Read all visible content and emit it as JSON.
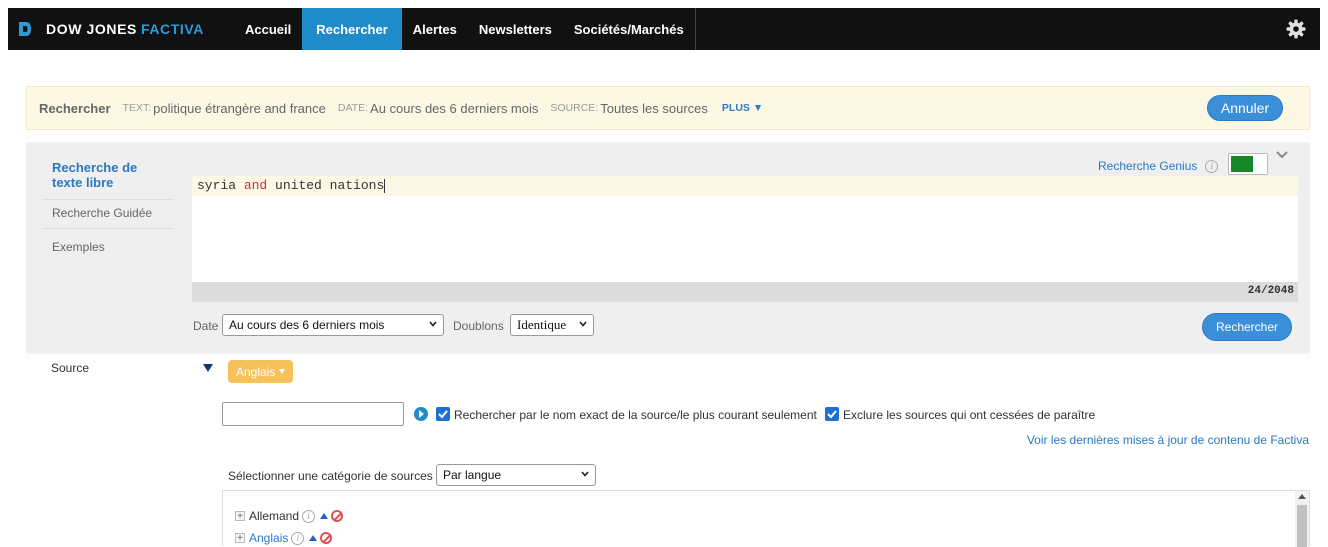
{
  "brand": {
    "name": "DOW JONES",
    "accent": "FACTIVA",
    "accent_color": "#2b9ad8"
  },
  "nav": {
    "items": [
      "Accueil",
      "Rechercher",
      "Alertes",
      "Newsletters",
      "Sociétés/Marchés"
    ],
    "active": "Rechercher"
  },
  "summary": {
    "title": "Rechercher",
    "text_key": "TEXT:",
    "text_value": "politique étrangère and france",
    "date_key": "DATE:",
    "date_value": "Au cours des 6 derniers mois",
    "source_key": "SOURCE:",
    "source_value": "Toutes les sources",
    "more": "PLUS",
    "cancel_label": "Annuler"
  },
  "sidebar": {
    "active": "Recherche de texte libre",
    "items": [
      "Recherche Guidée",
      "Exemples"
    ]
  },
  "genius": {
    "label": "Recherche Genius",
    "info": "i",
    "enabled": true,
    "toggle_color": "#16862a"
  },
  "editor": {
    "parts": [
      "syria",
      "and",
      "united nations"
    ],
    "counter": "24/2048"
  },
  "filters": {
    "date_label": "Date",
    "date_value": "Au cours des 6 derniers mois",
    "dup_label": "Doublons",
    "dup_value": "Identique",
    "search_label": "Rechercher"
  },
  "source": {
    "label": "Source",
    "pill": "Anglais",
    "checkbox1": "Rechercher par le nom exact de la source/le plus courant seulement",
    "checkbox2": "Exclure les sources qui ont cessées de paraître",
    "updates_link": "Voir les dernières mises à jour de contenu de Factiva",
    "category_label": "Sélectionner une catégorie de sources",
    "category_value": "Par langue",
    "tree": [
      "Allemand",
      "Anglais"
    ]
  }
}
